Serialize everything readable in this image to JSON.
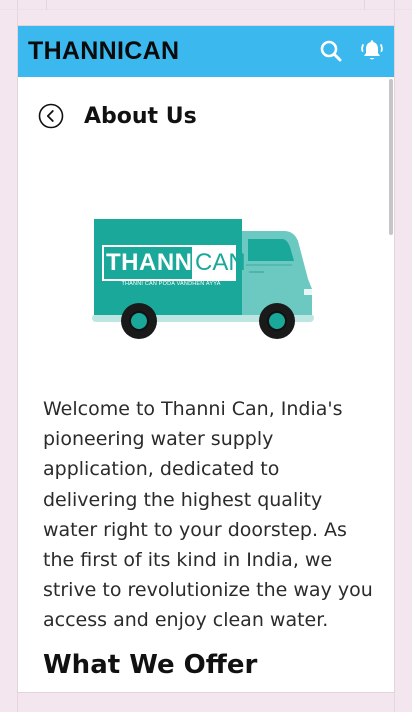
{
  "app": {
    "brand": "THANNICAN"
  },
  "header": {
    "search_icon": "search-icon",
    "bell_icon": "notification-bell-icon"
  },
  "page": {
    "title": "About Us",
    "back_icon": "back-arrow-icon"
  },
  "hero": {
    "logo_word_1": "THANNI",
    "logo_word_2": "CAN",
    "tagline": "THANNI CAN PODA VANDHEN AYYA"
  },
  "about": {
    "paragraph": "Welcome to Thanni Can, India's pioneering water supply application, dedicated to delivering the highest quality water right to your doorstep. As the first of its kind in India, we strive to revolutionize the way you access and enjoy clean water.",
    "section_heading": "What We Offer"
  },
  "colors": {
    "header_bg": "#3bb8ee",
    "truck_teal": "#1aa89a",
    "truck_cab": "#6cc9c2"
  }
}
